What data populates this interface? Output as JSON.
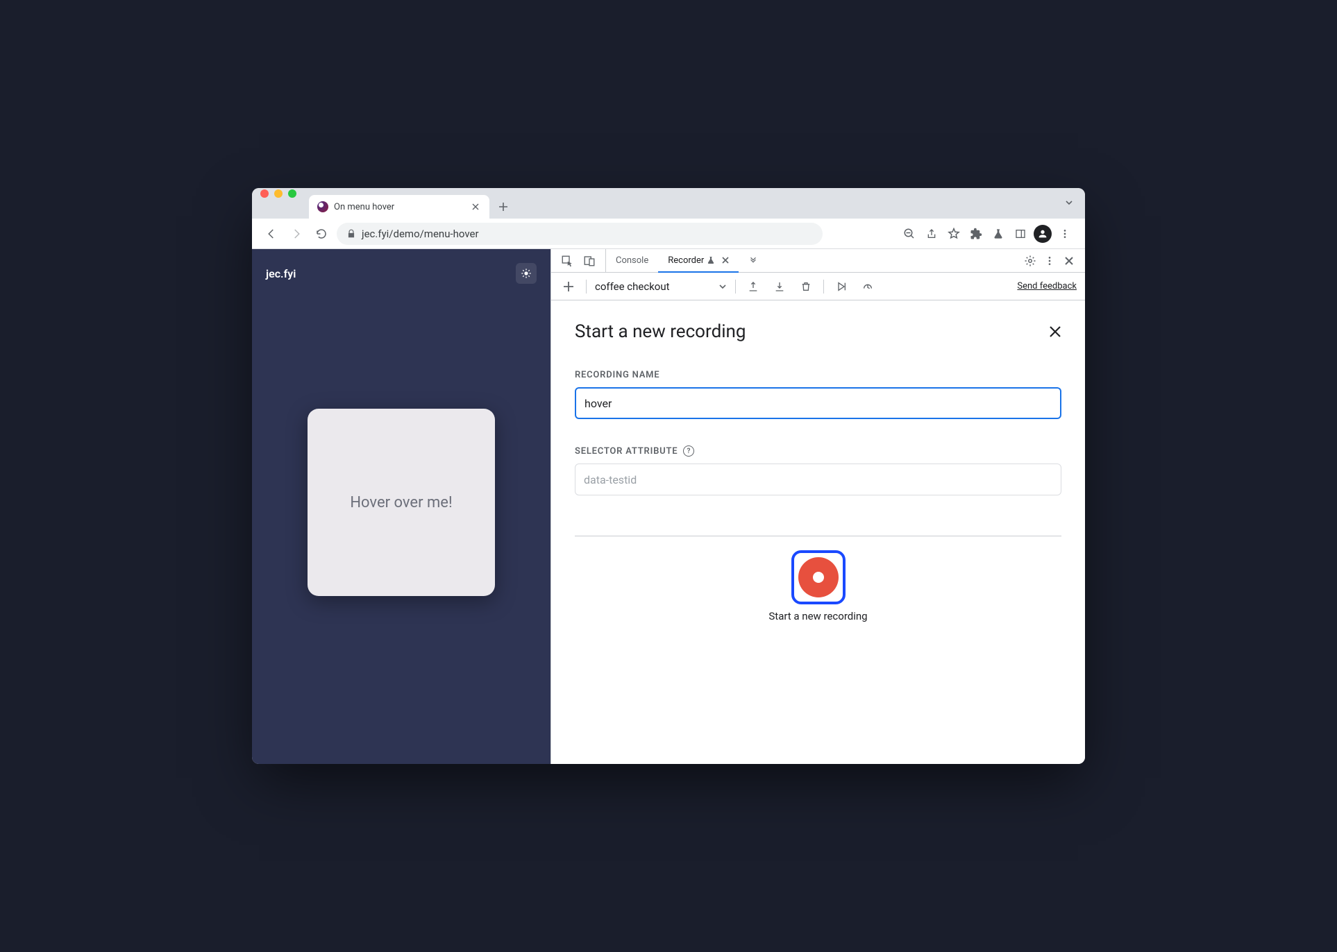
{
  "browser": {
    "tab_title": "On menu hover",
    "url": "jec.fyi/demo/menu-hover"
  },
  "page": {
    "site_name": "jec.fyi",
    "card_text": "Hover over me!"
  },
  "devtools": {
    "tabs": {
      "console": "Console",
      "recorder": "Recorder"
    },
    "toolbar": {
      "dropdown_value": "coffee checkout",
      "feedback": "Send feedback"
    },
    "form": {
      "title": "Start a new recording",
      "name_label": "RECORDING NAME",
      "name_value": "hover",
      "selector_label": "SELECTOR ATTRIBUTE",
      "selector_placeholder": "data-testid",
      "start_label": "Start a new recording"
    }
  }
}
